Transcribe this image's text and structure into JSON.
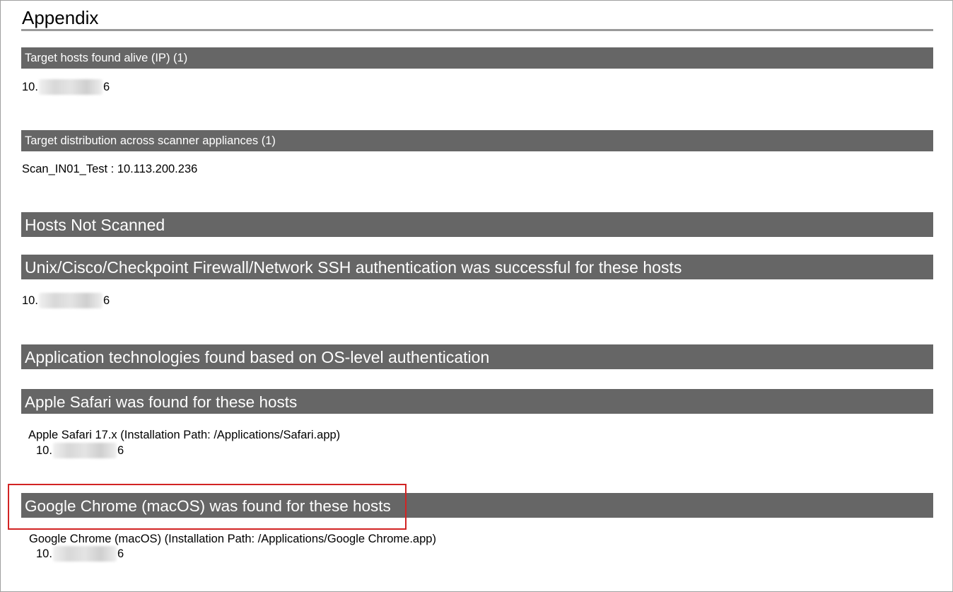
{
  "page": {
    "title": "Appendix"
  },
  "sections": {
    "alive_hosts": {
      "header": "Target hosts found alive (IP) (1)",
      "ip_prefix": "10.",
      "ip_suffix": "6"
    },
    "distribution": {
      "header": "Target distribution across scanner appliances (1)",
      "entry": "Scan_IN01_Test : 10.113.200.236"
    },
    "not_scanned": {
      "header": "Hosts Not Scanned"
    },
    "ssh_auth": {
      "header": "Unix/Cisco/Checkpoint Firewall/Network SSH authentication was successful for these hosts",
      "ip_prefix": "10.",
      "ip_suffix": "6"
    },
    "app_tech": {
      "header": "Application technologies found based on OS-level authentication"
    },
    "safari": {
      "header": "Apple Safari was found for these hosts",
      "detail": "Apple Safari 17.x (Installation Path: /Applications/Safari.app)",
      "ip_prefix": "10.",
      "ip_suffix": "6"
    },
    "chrome": {
      "header": "Google Chrome (macOS) was found for these hosts",
      "detail": "Google Chrome (macOS) (Installation Path: /Applications/Google Chrome.app)",
      "ip_prefix": "10.",
      "ip_suffix": "6"
    }
  },
  "colors": {
    "bar_background": "#666666",
    "bar_text": "#ffffff",
    "highlight_border": "#d22424",
    "title_rule": "#9a9a9a"
  }
}
